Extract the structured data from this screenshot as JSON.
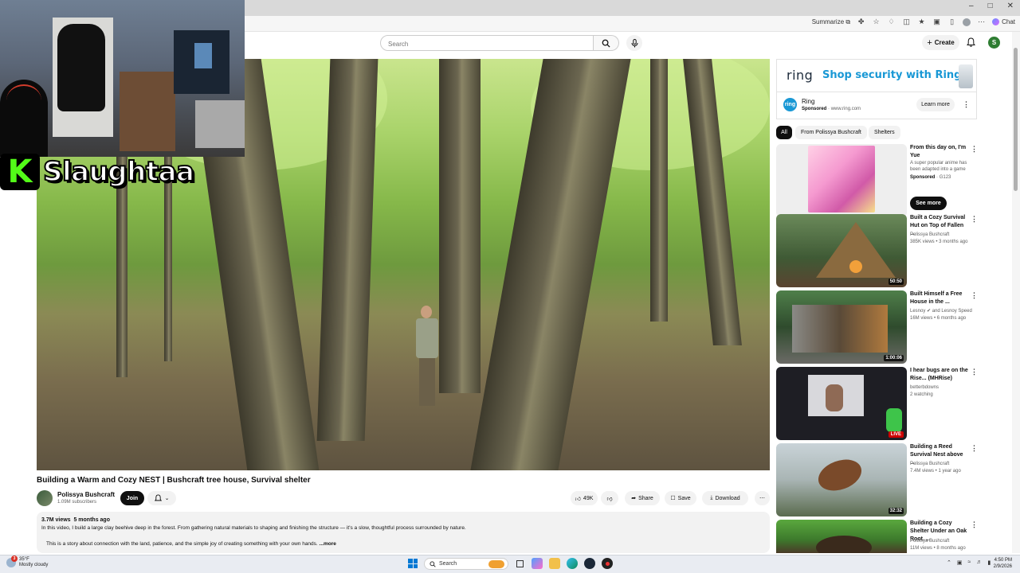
{
  "browser": {
    "toolbar": {
      "summarize_label": "Summarize",
      "chat_label": "Chat"
    }
  },
  "streamer": {
    "platform_icon": "kick-logo",
    "logo_letter": "K",
    "name": "Slaughtaa",
    "brand_color": "#53fc18"
  },
  "header": {
    "search_placeholder": "Search",
    "create_label": "Create",
    "user_initial": "S"
  },
  "video": {
    "title": "Building a Warm and Cozy NEST | Bushcraft tree house, Survival shelter",
    "channel_name": "Polissya Bushcraft",
    "subscribers": "1.09M subscribers",
    "join_label": "Join",
    "likes": "49K",
    "share_label": "Share",
    "save_label": "Save",
    "download_label": "Download",
    "views": "3.7M views",
    "age": "5 months ago",
    "description_line1": "In this video, I build a large clay beehive deep in the forest. From gathering natural materials to shaping and finishing the structure — it's a slow, thoughtful process surrounded by nature.",
    "description_line2": "This is a story about connection with the land, patience, and the simple joy of creating something with your own hands.",
    "more_label": "...more"
  },
  "ad": {
    "logo": "ring",
    "headline": "Shop security with Ring",
    "brand": "Ring",
    "sponsored": "Sponsored",
    "domain": "www.ring.com",
    "learn_more": "Learn more",
    "accent": "#1998d5"
  },
  "chips": [
    "All",
    "From Polissya Bushcraft",
    "Shelters"
  ],
  "recommendations": [
    {
      "title": "From this day on, I'm Yue",
      "desc": "A super popular anime has been adapted into a game",
      "sponsored": "Sponsored",
      "channel": "G123",
      "cta": "See more"
    },
    {
      "title": "Built a Cozy Survival Hut on Top of Fallen ...",
      "channel": "Polissya Bushcraft",
      "meta": "385K views • 3 months ago",
      "duration": "50:50"
    },
    {
      "title": "Built Himself a Free House in the ...",
      "channel": "Lesnoy",
      "channel_suffix": "and Lesnoy Speed",
      "meta": "16M views • 6 months ago",
      "duration": "1:00:06"
    },
    {
      "title": "I hear bugs are on the Rise... (MHRise)",
      "channel": "betterbdowns",
      "meta": "2 watching",
      "badge": "LIVE"
    },
    {
      "title": "Building a Reed Survival Nest above ...",
      "channel": "Polissya Bushcraft",
      "meta": "7.4M views • 1 year ago",
      "duration": "32:32"
    },
    {
      "title": "Building a Cozy Shelter Under an Oak Root. ...",
      "channel": "Polissya Bushcraft",
      "meta": "11M views • 8 months ago"
    }
  ],
  "taskbar": {
    "weather_temp": "35°F",
    "weather_desc": "Mostly cloudy",
    "weather_badge": "3",
    "search_label": "Search",
    "time": "4:50 PM",
    "date": "2/9/2026"
  }
}
